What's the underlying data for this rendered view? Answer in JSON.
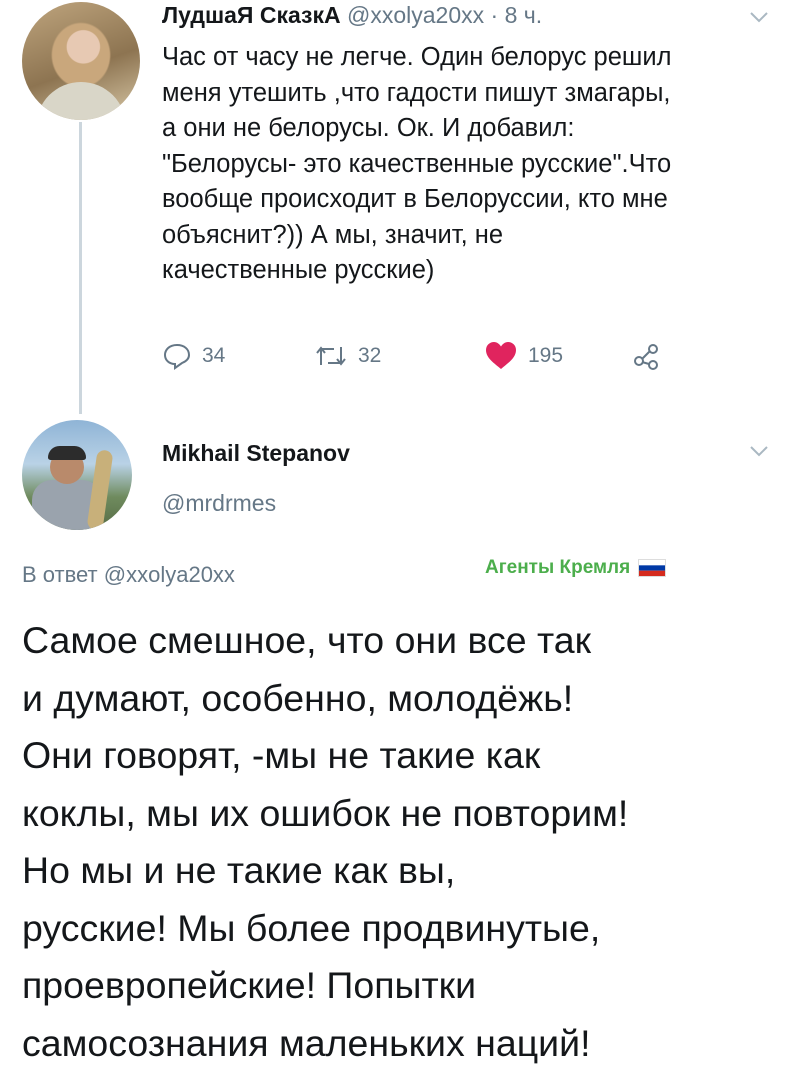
{
  "first_tweet": {
    "display_name": "ЛудшаЯ СказкА",
    "handle": "@xxolya20xx",
    "separator": "·",
    "time": "8 ч.",
    "lines": [
      "Час от часу не легче. Один белорус решил",
      "меня утешить ,что гадости пишут змагары,",
      "а они не белорусы. Ок. И добавил:",
      "\"Белорусы- это качественные русские\".Что",
      "вообще происходит в Белоруссии, кто мне",
      "объяснит?)) А мы, значит, не",
      "качественные русские)"
    ],
    "actions": {
      "reply_icon": "reply-icon",
      "reply_count": "34",
      "retweet_icon": "retweet-icon",
      "retweet_count": "32",
      "like_icon": "heart-icon",
      "like_count": "195",
      "share_icon": "share-icon"
    },
    "like_color": "#e0245e"
  },
  "second_tweet": {
    "display_name": "Mikhail Stepanov",
    "handle": "@mrdrmes",
    "reply_prefix": "В ответ",
    "reply_mention": "@xxolya20xx",
    "lines": [
      "Самое смешное, что они все так",
      "и думают, особенно, молодёжь!",
      "Они говорят, -мы не такие как",
      "коклы, мы их ошибок не повторим!",
      "Но мы и не такие как вы,",
      "русские! Мы более продвинутые,",
      "проевропейские! Попытки",
      "самосознания маленьких наций!"
    ]
  },
  "watermark": {
    "text": "Агенты Кремля",
    "color": "#4cae4c",
    "flag_colors": [
      "#ffffff",
      "#0039a6",
      "#d52b1e"
    ]
  },
  "colors": {
    "text": "#14171a",
    "secondary": "#657786",
    "thread_line": "#ccd6dd"
  }
}
